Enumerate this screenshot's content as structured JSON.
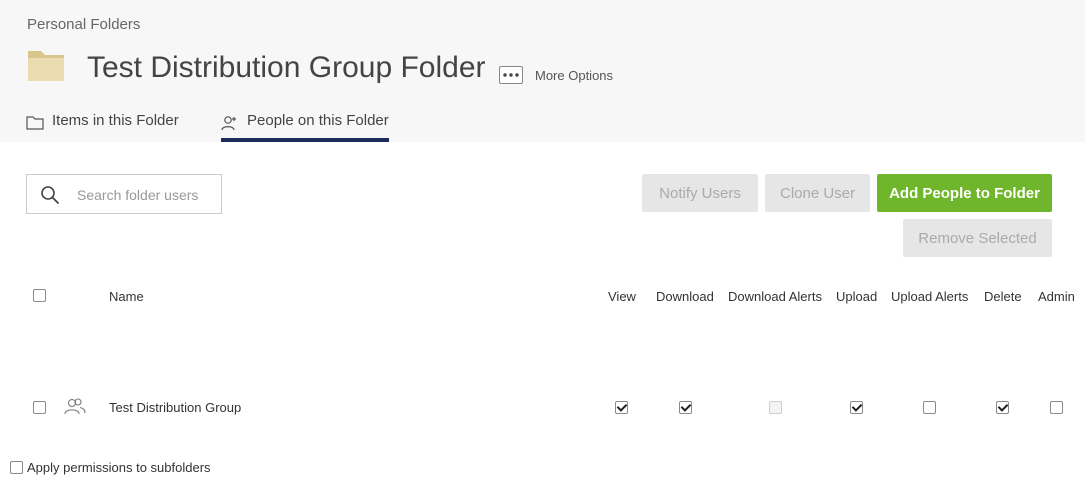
{
  "breadcrumb": "Personal Folders",
  "folder": {
    "title": "Test Distribution Group Folder",
    "more_options_label": "More Options",
    "icon": "folder-icon"
  },
  "tabs": [
    {
      "label": "Items in this Folder",
      "icon": "folder-outline-icon",
      "active": false
    },
    {
      "label": "People on this Folder",
      "icon": "add-person-icon",
      "active": true
    }
  ],
  "search": {
    "placeholder": "Search folder users",
    "value": ""
  },
  "toolbar": {
    "notify_label": "Notify Users",
    "clone_label": "Clone User",
    "add_label": "Add People to Folder",
    "remove_label": "Remove Selected"
  },
  "table": {
    "columns": [
      "Name",
      "View",
      "Download",
      "Download Alerts",
      "Upload",
      "Upload Alerts",
      "Delete",
      "Admin"
    ],
    "rows": [
      {
        "name": "Test Distribution Group",
        "icon": "group-icon",
        "selected": false,
        "view": true,
        "download": true,
        "download_alerts": null,
        "upload": true,
        "upload_alerts": false,
        "delete": true,
        "admin": false
      }
    ]
  },
  "apply_subfolders": {
    "label": "Apply permissions to subfolders",
    "checked": false
  },
  "colors": {
    "accent_green": "#70b62c",
    "tab_underline": "#1c2c5a",
    "folder_fill": "#e9d9a6",
    "header_bg": "#f7f7f8"
  }
}
